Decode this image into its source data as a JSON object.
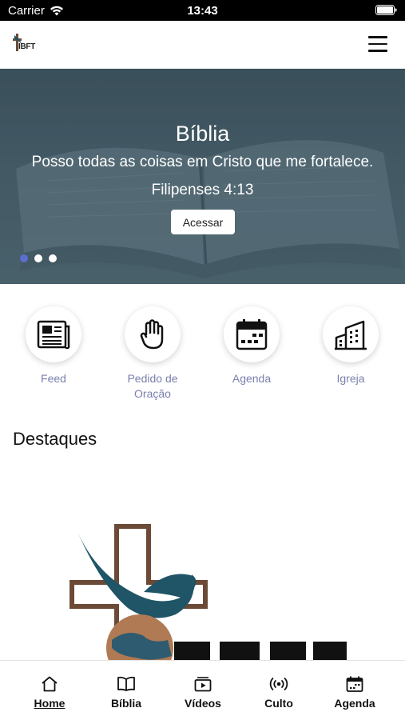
{
  "status_bar": {
    "carrier": "Carrier",
    "time": "13:43"
  },
  "header": {
    "logo_text": "IBFT"
  },
  "banner": {
    "title": "Bíblia",
    "verse": "Posso todas as coisas em Cristo que me fortalece.",
    "reference": "Filipenses 4:13",
    "button_label": "Acessar",
    "slide_count": 3,
    "active_slide": 1
  },
  "quick_actions": [
    {
      "label": "Feed",
      "icon": "newspaper-icon"
    },
    {
      "label": "Pedido de\nOração",
      "icon": "raised-hand-icon"
    },
    {
      "label": "Agenda",
      "icon": "calendar-icon"
    },
    {
      "label": "Igreja",
      "icon": "building-icon"
    }
  ],
  "highlights": {
    "title": "Destaques"
  },
  "tab_bar": {
    "items": [
      {
        "label": "Home",
        "icon": "home-icon",
        "active": true
      },
      {
        "label": "Bíblia",
        "icon": "book-icon",
        "active": false
      },
      {
        "label": "Vídeos",
        "icon": "video-icon",
        "active": false
      },
      {
        "label": "Culto",
        "icon": "broadcast-icon",
        "active": false
      },
      {
        "label": "Agenda",
        "icon": "calendar-icon",
        "active": false
      }
    ]
  },
  "colors": {
    "accent_label": "#7a7fae",
    "active_dot": "#5a6fd0",
    "logo_teal": "#1f5566",
    "logo_brown": "#6b4a36"
  }
}
